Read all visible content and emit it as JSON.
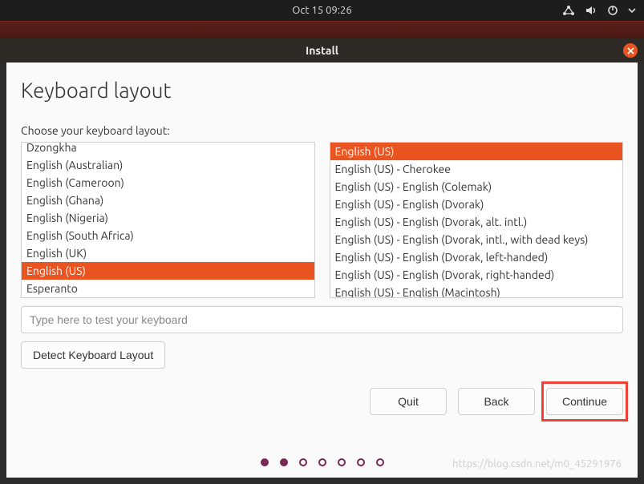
{
  "topbar": {
    "datetime": "Oct 15  09:26"
  },
  "titlebar": {
    "title": "Install"
  },
  "page": {
    "heading": "Keyboard layout",
    "prompt": "Choose your keyboard layout:"
  },
  "left_list": {
    "items": [
      "Dzongkha",
      "English (Australian)",
      "English (Cameroon)",
      "English (Ghana)",
      "English (Nigeria)",
      "English (South Africa)",
      "English (UK)",
      "English (US)",
      "Esperanto"
    ],
    "selected_index": 7
  },
  "right_list": {
    "items": [
      "English (US)",
      "English (US) - Cherokee",
      "English (US) - English (Colemak)",
      "English (US) - English (Dvorak)",
      "English (US) - English (Dvorak, alt. intl.)",
      "English (US) - English (Dvorak, intl., with dead keys)",
      "English (US) - English (Dvorak, left-handed)",
      "English (US) - English (Dvorak, right-handed)",
      "English (US) - English (Macintosh)"
    ],
    "selected_index": 0
  },
  "test_input": {
    "placeholder": "Type here to test your keyboard",
    "value": ""
  },
  "buttons": {
    "detect": "Detect Keyboard Layout",
    "quit": "Quit",
    "back": "Back",
    "continue": "Continue"
  },
  "progress": {
    "total": 7,
    "filled": 2
  },
  "watermark": "https://blog.csdn.net/m0_45291976",
  "colors": {
    "accent": "#e95420",
    "purple": "#772953"
  }
}
